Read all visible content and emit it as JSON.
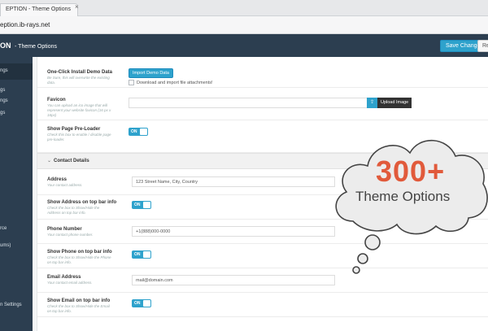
{
  "browser": {
    "tab_title": "EPTION - Theme Options",
    "tab_close": "×",
    "url": "eption.ib-rays.net"
  },
  "header": {
    "brand": "ON",
    "subtitle": "- Theme Options",
    "save_label": "Save Changes",
    "reset_label": "Re"
  },
  "sidebar": {
    "items": [
      {
        "label": "ngs",
        "active": true
      },
      {
        "label": "ngs"
      },
      {
        "label": "gs"
      },
      {
        "label": "gs"
      },
      {
        "label": "rce"
      },
      {
        "label": "ums)"
      },
      {
        "label": "n Settings"
      }
    ]
  },
  "options": {
    "demo": {
      "label": "One-Click Install Demo Data",
      "desc": "Be Sure, this will overwrite the existing data.",
      "button": "Import Demo Data",
      "checkbox": "Download and import file attachments!"
    },
    "favicon": {
      "label": "Favicon",
      "desc": "You can upload an ico image that will represent your website favicon (16 px x 16px)",
      "button": "Upload Image",
      "icon": "upload-icon"
    },
    "preloader": {
      "label": "Show Page Pre-Loader",
      "desc": "Check this box to enable / disable page pre-loader.",
      "toggle": "ON"
    },
    "contact_section": {
      "title": "Contact Details",
      "icon": "chevron-down-icon"
    },
    "address": {
      "label": "Address",
      "desc": "Your contact address.",
      "value": "123 Street Name, City, Country"
    },
    "address_topbar": {
      "label": "Show Address on top bar info",
      "desc": "Check the box to Show/Hide the Address on top bar info.",
      "toggle": "ON"
    },
    "phone": {
      "label": "Phone Number",
      "desc": "Your contact phone number.",
      "value": "+1(888)000-0000"
    },
    "phone_topbar": {
      "label": "Show Phone on top bar info",
      "desc": "Check the box to Show/Hide the Phone on top bar info.",
      "toggle": "ON"
    },
    "email": {
      "label": "Email Address",
      "desc": "Your contact email address.",
      "value": "mail@domain.com"
    },
    "email_topbar": {
      "label": "Show Email on top bar info",
      "desc": "Check the box to Show/Hide the Email on top bar info.",
      "toggle": "ON"
    }
  },
  "promo": {
    "big": "300+",
    "small": "Theme Options"
  },
  "colors": {
    "header": "#2c3e50",
    "accent": "#2ea2cc",
    "promo_orange": "#e15a3b"
  }
}
